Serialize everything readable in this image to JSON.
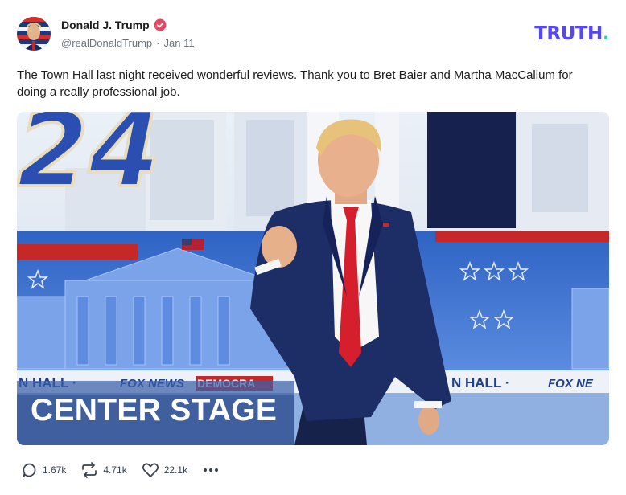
{
  "post": {
    "author": {
      "display_name": "Donald J. Trump",
      "handle": "@realDonaldTrump",
      "separator": "·",
      "date": "Jan 11",
      "verified": true,
      "verified_color": "#e54860"
    },
    "brand": {
      "logo_text": "TRUTH",
      "logo_dot": ".",
      "logo_color": "#5448ee",
      "logo_dot_color": "#2dd4b4"
    },
    "text": "The Town Hall last night received wonderful reviews. Thank you to Bret Baier and Martha MacCallum for doing a really professional job.",
    "image": {
      "banner_number": "24",
      "lower_third_left": "N HALL ·",
      "lower_third_left_logo": "FOX NEWS",
      "lower_third_left_tag": "DEMOCRA",
      "lower_third_right": "N HALL ·",
      "lower_third_right_logo": "FOX NE",
      "caption": "CENTER STAGE"
    },
    "actions": {
      "replies": "1.67k",
      "retruths": "4.71k",
      "likes": "22.1k",
      "more_icon": "ellipsis-icon"
    }
  }
}
